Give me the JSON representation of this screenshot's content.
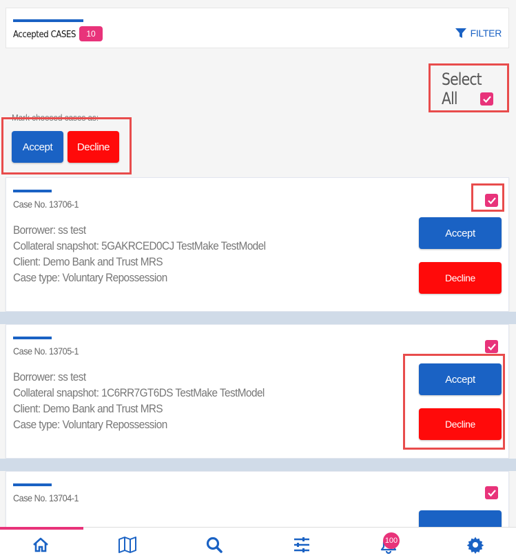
{
  "header": {
    "title": "Accepted CASES",
    "count": "10",
    "filter_label": "FILTER"
  },
  "select_all": {
    "label": "Select All",
    "checked": true
  },
  "bulk": {
    "label": "Mark choosed cases as:",
    "accept_label": "Accept",
    "decline_label": "Decline"
  },
  "cases": [
    {
      "case_no": "Case No. 13706-1",
      "borrower": "Borrower: ss test",
      "collateral": "Collateral snapshot: 5GAKRCED0CJ TestMake TestModel",
      "client": "Client: Demo Bank and Trust MRS",
      "case_type": "Case type: Voluntary Repossession",
      "accept_label": "Accept",
      "decline_label": "Decline",
      "checked": true
    },
    {
      "case_no": "Case No. 13705-1",
      "borrower": "Borrower: ss test",
      "collateral": "Collateral snapshot: 1C6RR7GT6DS TestMake TestModel",
      "client": "Client: Demo Bank and Trust MRS",
      "case_type": "Case type: Voluntary Repossession",
      "accept_label": "Accept",
      "decline_label": "Decline",
      "checked": true
    },
    {
      "case_no": "Case No. 13704-1",
      "checked": true
    }
  ],
  "bottom_nav": {
    "items": [
      "home-icon",
      "map-icon",
      "search-icon",
      "sliders-icon",
      "bell-icon",
      "gear-icon"
    ],
    "notification_count": "100"
  },
  "colors": {
    "primary": "#1a62c4",
    "danger": "#ff0a0a",
    "accent": "#e8337a"
  }
}
